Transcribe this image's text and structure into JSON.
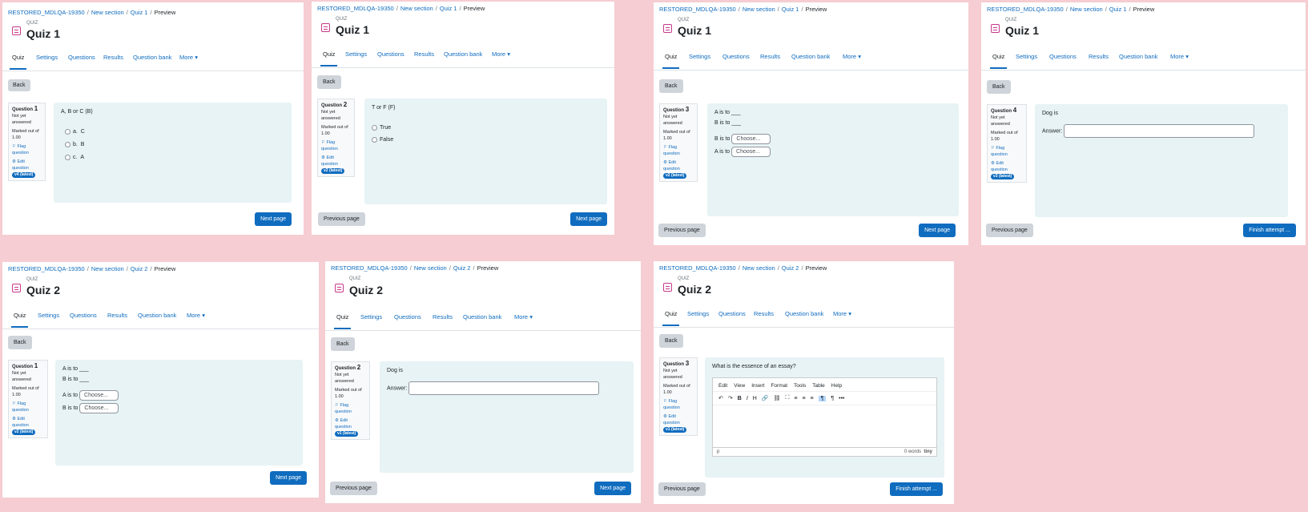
{
  "breadcrumbs": {
    "course": "RESTORED_MDLQA-19350",
    "section": "New section",
    "preview": "Preview"
  },
  "module_label": "QUIZ",
  "tabs": [
    "Quiz",
    "Settings",
    "Questions",
    "Results",
    "Question bank",
    "More"
  ],
  "buttons": {
    "back": "Back",
    "next": "Next page",
    "previous": "Previous page",
    "finish": "Finish attempt ..."
  },
  "question_info": {
    "question_word": "Question",
    "status_line1": "Not yet",
    "status_line2": "answered",
    "marked_line1": "Marked out of",
    "marked_line2": "1.00",
    "flag_line1": "Flag",
    "flag_line2": "question",
    "edit_line1": "Edit",
    "edit_line2": "question"
  },
  "answer_label": "Answer:",
  "select_placeholder": "Choose...",
  "panels": [
    {
      "quiz": "Quiz 1",
      "qnum": "1",
      "version": "v4 (latest)",
      "prompt": "A, B or C (B)",
      "options": [
        [
          "a.",
          "C"
        ],
        [
          "b.",
          "B"
        ],
        [
          "c.",
          "A"
        ]
      ]
    },
    {
      "quiz": "Quiz 1",
      "qnum": "2",
      "version": "v2 (latest)",
      "prompt": "T or F (F)",
      "options": [
        "True",
        "False"
      ]
    },
    {
      "quiz": "Quiz 1",
      "qnum": "3",
      "version": "v2 (latest)",
      "stems": [
        "A is to ___",
        "B is to ___"
      ],
      "rows": [
        "B is to",
        "A is to"
      ]
    },
    {
      "quiz": "Quiz 1",
      "qnum": "4",
      "version": "v3 (latest)",
      "prompt": "Dog is"
    },
    {
      "quiz": "Quiz 2",
      "qnum": "1",
      "version": "v2 (latest)",
      "stems": [
        "A is to ___",
        "B is to ___"
      ],
      "rows": [
        "A is to",
        "B is to"
      ]
    },
    {
      "quiz": "Quiz 2",
      "qnum": "2",
      "version": "v1 (latest)",
      "prompt": "Dog is"
    },
    {
      "quiz": "Quiz 2",
      "qnum": "3",
      "version": "v1 (latest)",
      "prompt": "What is the essence of an essay?"
    }
  ],
  "editor": {
    "menu": [
      "Edit",
      "View",
      "Insert",
      "Format",
      "Tools",
      "Table",
      "Help"
    ],
    "tools": [
      "↶",
      "↷",
      "B",
      "I",
      "H",
      "🔗",
      "⛓",
      "⛶",
      "≡",
      "≡",
      "≡",
      "¶",
      "¶",
      "•••"
    ],
    "path": "p",
    "words": "0 words",
    "brand": "tiny"
  }
}
